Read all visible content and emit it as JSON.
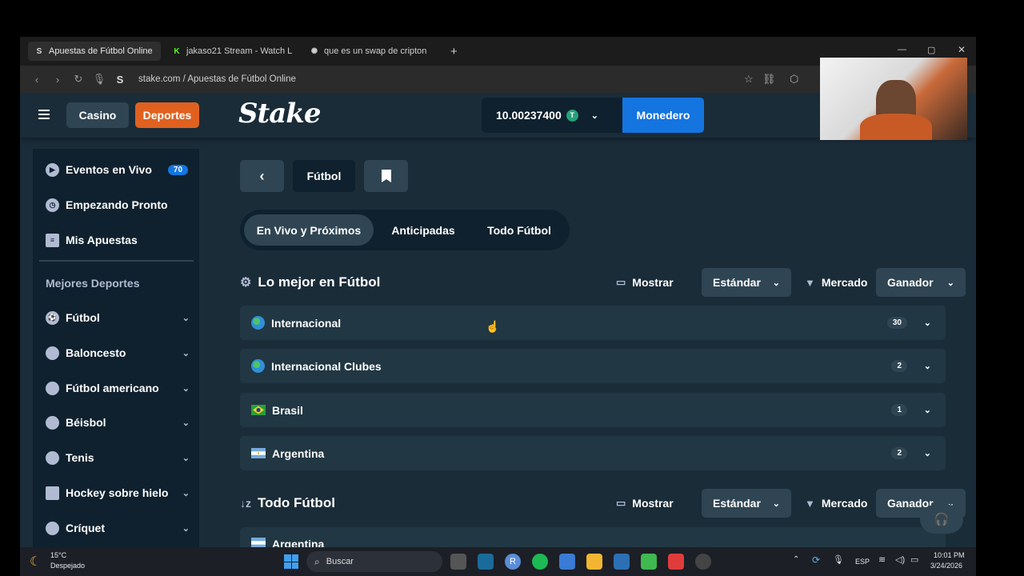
{
  "browser": {
    "tabs": [
      {
        "label": "Apuestas de Fútbol Online",
        "icon": "stake-s-icon",
        "active": true
      },
      {
        "label": "jakaso21 Stream - Watch L",
        "icon": "kick-k-icon",
        "active": false
      },
      {
        "label": "que es un swap de cripton",
        "icon": "ai-assistant-icon",
        "active": false
      }
    ],
    "new_tab": "+",
    "url": "stake.com / Apuestas de Fútbol Online",
    "window_controls": [
      "—",
      "▢",
      "✕"
    ]
  },
  "topnav": {
    "casino_label": "Casino",
    "deportes_label": "Deportes",
    "logo": "Stake",
    "balance": "10.00237400",
    "currency_symbol": "T",
    "wallet_label": "Monedero"
  },
  "sidebar": {
    "top_items": [
      {
        "label": "Eventos en Vivo",
        "icon": "play-circle-icon",
        "badge": "70"
      },
      {
        "label": "Empezando Pronto",
        "icon": "stopwatch-icon"
      },
      {
        "label": "Mis Apuestas",
        "icon": "bet-slip-icon"
      }
    ],
    "section_title": "Mejores Deportes",
    "sports": [
      {
        "label": "Fútbol",
        "icon": "soccer-ball-icon"
      },
      {
        "label": "Baloncesto",
        "icon": "basketball-icon"
      },
      {
        "label": "Fútbol americano",
        "icon": "american-football-icon"
      },
      {
        "label": "Béisbol",
        "icon": "baseball-icon"
      },
      {
        "label": "Tenis",
        "icon": "tennis-ball-icon"
      },
      {
        "label": "Hockey sobre hielo",
        "icon": "hockey-stick-icon"
      },
      {
        "label": "Críquet",
        "icon": "cricket-ball-icon"
      }
    ]
  },
  "main": {
    "back_button": "‹",
    "sport_title": "Fútbol",
    "segments": [
      "En Vivo y Próximos",
      "Anticipadas",
      "Todo Fútbol"
    ],
    "section1": {
      "title": "Lo mejor en Fútbol",
      "show_label": "Mostrar",
      "show_value": "Estándar",
      "market_label": "Mercado",
      "market_value": "Ganador"
    },
    "leagues": [
      {
        "name": "Internacional",
        "count": "30",
        "flag": "globe"
      },
      {
        "name": "Internacional Clubes",
        "count": "2",
        "flag": "globe"
      },
      {
        "name": "Brasil",
        "count": "1",
        "flag": "brazil"
      },
      {
        "name": "Argentina",
        "count": "2",
        "flag": "argentina"
      }
    ],
    "section2": {
      "title": "Todo Fútbol",
      "show_label": "Mostrar",
      "show_value": "Estándar",
      "market_label": "Mercado",
      "market_value": "Ganador"
    },
    "partial_row": "Argentina"
  },
  "taskbar": {
    "weather_temp": "15°C",
    "weather_desc": "Despejado",
    "search_placeholder": "Buscar",
    "lang": "ESP",
    "time": "10:01 PM",
    "date": "3/24/2026"
  }
}
